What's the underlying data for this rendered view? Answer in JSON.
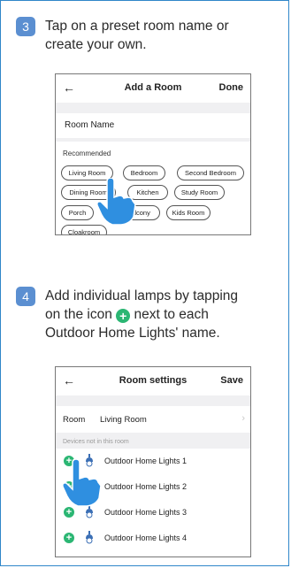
{
  "step3": {
    "number": "3",
    "instruction": "Tap on a preset room name or create your own.",
    "screen": {
      "back_icon": "back-arrow-icon",
      "title": "Add a Room",
      "action": "Done",
      "room_name_label": "Room Name",
      "recommended_label": "Recommended",
      "chips": [
        "Living Room",
        "Bedroom",
        "Second Bedroom",
        "Dining Room",
        "Kitchen",
        "Study Room",
        "Porch",
        "Balcony",
        "Kids Room",
        "Cloakroom"
      ]
    }
  },
  "step4": {
    "number": "4",
    "instruction_part1": "Add individual lamps by tapping on the icon",
    "instruction_part2": "next to each Outdoor Home Lights' name.",
    "screen": {
      "back_icon": "back-arrow-icon",
      "title": "Room settings",
      "action": "Save",
      "room_label": "Room",
      "room_value": "Living Room",
      "section_label": "Devices not in this room",
      "devices": [
        "Outdoor Home Lights 1",
        "Outdoor Home Lights 2",
        "Outdoor Home Lights 3",
        "Outdoor Home Lights 4"
      ]
    }
  },
  "colors": {
    "accent_green": "#2bb673",
    "badge_blue": "#5b8fd1",
    "tap_hand_blue": "#2f8fe0",
    "frame_blue": "#2f86c9"
  }
}
